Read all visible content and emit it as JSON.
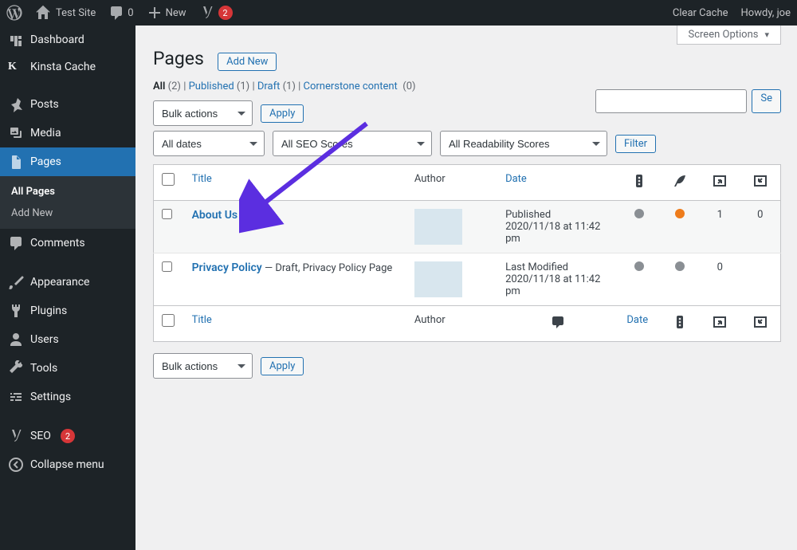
{
  "adminbar": {
    "site": "Test Site",
    "comments": "0",
    "new": "New",
    "yoast_badge": "2",
    "clear_cache": "Clear Cache",
    "howdy": "Howdy, joe"
  },
  "sidebar": {
    "dashboard": "Dashboard",
    "kinsta": "Kinsta Cache",
    "posts": "Posts",
    "media": "Media",
    "pages": "Pages",
    "all_pages": "All Pages",
    "add_new": "Add New",
    "comments": "Comments",
    "appearance": "Appearance",
    "plugins": "Plugins",
    "users": "Users",
    "tools": "Tools",
    "settings": "Settings",
    "seo": "SEO",
    "seo_count": "2",
    "collapse": "Collapse menu"
  },
  "main": {
    "title": "Pages",
    "add_new": "Add New",
    "screen_options": "Screen Options",
    "filters": {
      "all_label": "All",
      "all_count": "(2)",
      "published_label": "Published",
      "published_count": "(1)",
      "draft_label": "Draft",
      "draft_count": "(1)",
      "cornerstone_label": "Cornerstone content",
      "cornerstone_count": "(0)"
    },
    "bulk_actions": "Bulk actions",
    "apply": "Apply",
    "all_dates": "All dates",
    "all_seo": "All SEO Scores",
    "all_readability": "All Readability Scores",
    "filter": "Filter",
    "search_placeholder": "",
    "search_btn": "Se",
    "cols": {
      "title": "Title",
      "author": "Author",
      "date": "Date"
    },
    "rows": [
      {
        "title": "About Us",
        "extra": "",
        "date_label": "Published",
        "date": "2020/11/18 at 11:42 pm",
        "dot1": "gray",
        "dot2": "orange",
        "links": "1",
        "links2": "0"
      },
      {
        "title": "Privacy Policy",
        "extra": " — Draft, Privacy Policy Page",
        "date_label": "Last Modified",
        "date": "2020/11/18 at 11:42 pm",
        "dot1": "gray",
        "dot2": "gray",
        "links": "0",
        "links2": ""
      }
    ]
  }
}
